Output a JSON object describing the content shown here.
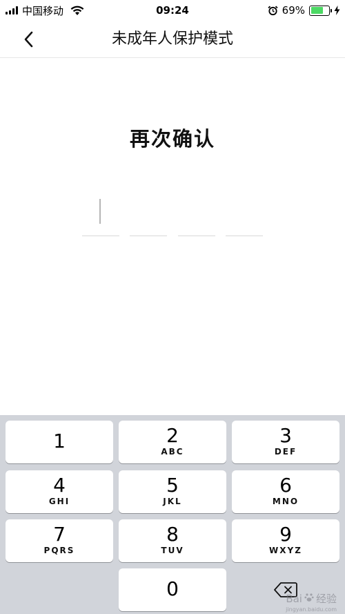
{
  "status_bar": {
    "carrier": "中国移动",
    "time": "09:24",
    "battery_percent": "69%",
    "battery_level": 0.69,
    "battery_color": "#4cd964"
  },
  "nav": {
    "title": "未成年人保护模式",
    "back_icon": "chevron-left-icon"
  },
  "pin": {
    "heading": "再次确认",
    "slot_count": 4,
    "filled": 0
  },
  "keyboard": {
    "keys": [
      {
        "digit": "1",
        "letters": ""
      },
      {
        "digit": "2",
        "letters": "ABC"
      },
      {
        "digit": "3",
        "letters": "DEF"
      },
      {
        "digit": "4",
        "letters": "GHI"
      },
      {
        "digit": "5",
        "letters": "JKL"
      },
      {
        "digit": "6",
        "letters": "MNO"
      },
      {
        "digit": "7",
        "letters": "PQRS"
      },
      {
        "digit": "8",
        "letters": "TUV"
      },
      {
        "digit": "9",
        "letters": "WXYZ"
      },
      {
        "digit": "0",
        "letters": ""
      }
    ],
    "delete_icon": "backspace-icon",
    "background": "#d1d4da"
  },
  "watermark": {
    "text": "Bai",
    "text2": "经验",
    "url": "jingyan.baidu.com"
  }
}
